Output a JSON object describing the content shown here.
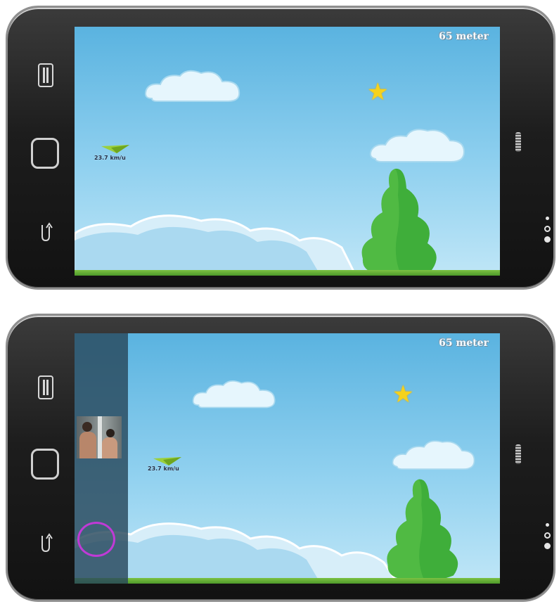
{
  "phones": [
    {
      "id": "phone-top",
      "game": {
        "distance_text": "65 meter",
        "speed_text": "23.7 km/u"
      },
      "overlay_visible": false
    },
    {
      "id": "phone-bottom",
      "game": {
        "distance_text": "65 meter",
        "speed_text": "23.7 km/u"
      },
      "overlay_visible": true,
      "overlay": {
        "has_video_thumbnail": true,
        "record_circle_color": "#c03ad6"
      }
    }
  ],
  "colors": {
    "sky_top": "#5ab3e0",
    "sky_bottom": "#bfe6f7",
    "tree_green": "#3fae3a",
    "ground_green": "#6bb63a",
    "star_yellow": "#f6d21b",
    "phone_body": "#1d1d1d"
  },
  "icons": {
    "menu": "menu-icon",
    "home": "home-icon",
    "back": "back-icon",
    "star": "star-icon",
    "plane": "paper-plane-icon"
  }
}
